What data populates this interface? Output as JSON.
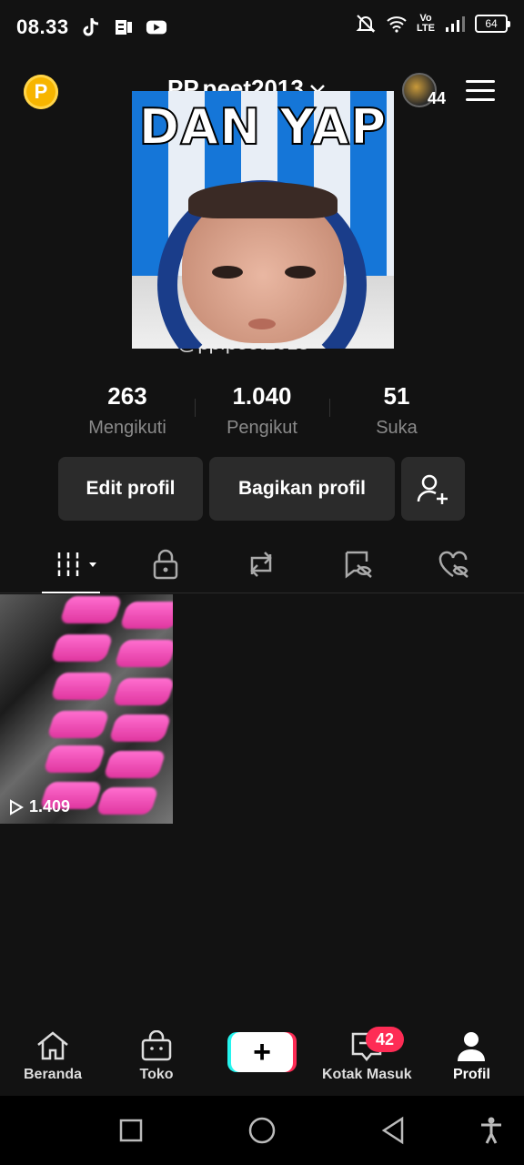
{
  "status_bar": {
    "time": "08.33",
    "volte_top": "Vo",
    "volte_bottom": "LTE",
    "battery": "64"
  },
  "header": {
    "coin_label": "P",
    "username": "PP.peet2013",
    "visitor_count": "44"
  },
  "profile": {
    "image_caption": "DAN YAP",
    "handle": "@pp.peet2013"
  },
  "stats": [
    {
      "value": "263",
      "label": "Mengikuti"
    },
    {
      "value": "1.040",
      "label": "Pengikut"
    },
    {
      "value": "51",
      "label": "Suka"
    }
  ],
  "actions": {
    "edit_label": "Edit profil",
    "share_label": "Bagikan profil"
  },
  "tabs": [
    "videos-grid-icon",
    "lock-icon",
    "repost-icon",
    "hidden-icon",
    "liked-icon"
  ],
  "videos": [
    {
      "views": "1.409"
    }
  ],
  "bottom_nav": {
    "home": "Beranda",
    "shop": "Toko",
    "inbox": "Kotak Masuk",
    "inbox_badge": "42",
    "profile": "Profil"
  },
  "colors": {
    "background": "#121212",
    "accent_red": "#fe2c55",
    "accent_cyan": "#25f4ee",
    "coin": "#f7b500"
  }
}
